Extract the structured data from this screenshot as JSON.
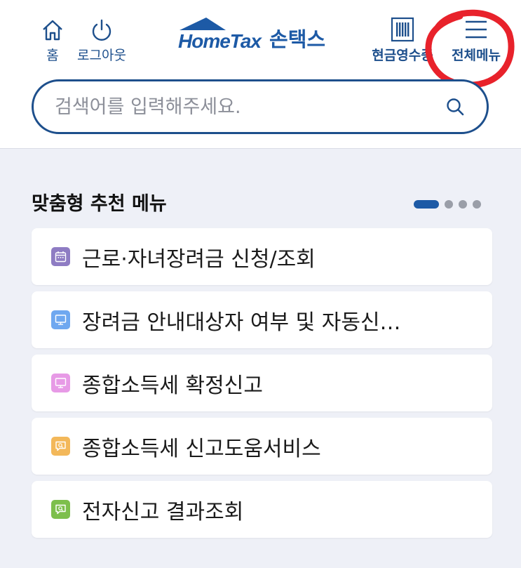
{
  "header": {
    "home_label": "홈",
    "logout_label": "로그아웃",
    "logo_text": "HomeTax",
    "logo_korean": "손택스",
    "receipt_label": "현금영수증",
    "all_menu_label": "전체메뉴"
  },
  "search": {
    "placeholder": "검색어를 입력해주세요."
  },
  "recommend": {
    "title": "맞춤형 추천 메뉴",
    "page_count": 4,
    "current_page": 1,
    "items": [
      {
        "label": "근로·자녀장려금 신청/조회",
        "icon": "calendar-icon",
        "color": "#8e7cc3"
      },
      {
        "label": "장려금 안내대상자 여부 및 자동신…",
        "icon": "monitor-icon",
        "color": "#6fa8f0"
      },
      {
        "label": "종합소득세 확정신고",
        "icon": "monitor-icon",
        "color": "#e79ae6"
      },
      {
        "label": "종합소득세 신고도움서비스",
        "icon": "chat-search-icon",
        "color": "#f3b85a"
      },
      {
        "label": "전자신고 결과조회",
        "icon": "chat-search-icon",
        "color": "#7dbf4c"
      }
    ]
  },
  "colors": {
    "brand": "#1d5aa6",
    "header_text": "#1d4f8c",
    "annotation": "#e8222b",
    "background": "#eef0f7"
  }
}
